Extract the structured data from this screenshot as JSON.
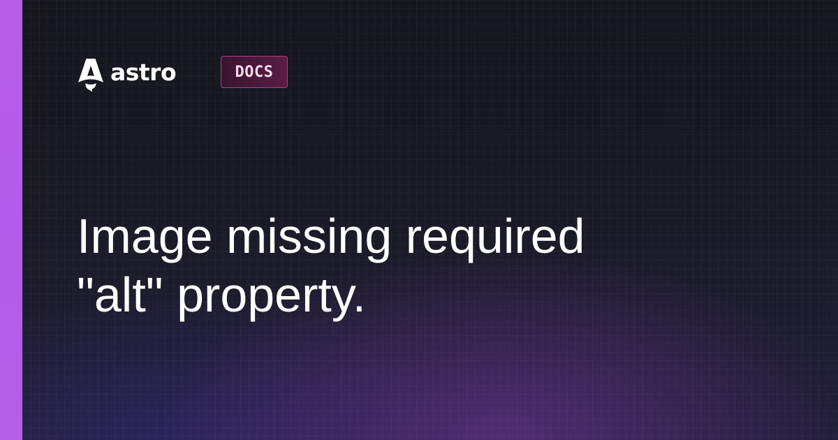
{
  "brand": {
    "logo_icon": "astro-rocket-icon",
    "wordmark": "astro",
    "badge": "DOCS"
  },
  "headline": {
    "line1": "Image missing required",
    "line2": "\"alt\" property."
  },
  "colors": {
    "accent_bar": "#b65ee6",
    "background": "#17181f",
    "badge_border": "#a14583",
    "badge_fill": "#5a1c45",
    "text": "#ffffff"
  }
}
